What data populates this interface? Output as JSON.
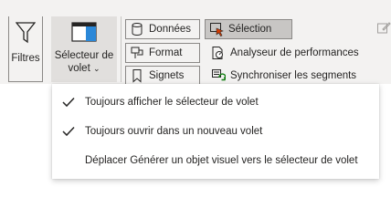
{
  "ribbon": {
    "filtres_label": "Filtres",
    "selecteur_label_line1": "Sélecteur de",
    "selecteur_label_line2": "volet",
    "buttons": {
      "donnees": "Données",
      "format": "Format",
      "signets": "Signets",
      "selection": "Sélection",
      "analyseur": "Analyseur de performances",
      "synchroniser": "Synchroniser les segments"
    }
  },
  "dropdown": {
    "items": [
      {
        "label": "Toujours afficher le sélecteur de volet",
        "checked": true
      },
      {
        "label": "Toujours ouvrir dans un nouveau volet",
        "checked": true
      },
      {
        "label": "Déplacer Générer un objet visuel vers le sélecteur de volet",
        "checked": false
      }
    ]
  },
  "colors": {
    "ribbon_bg": "#f3f2f1",
    "accent_blue": "#2b88d8",
    "pressed_bg": "#e1dfdd"
  }
}
